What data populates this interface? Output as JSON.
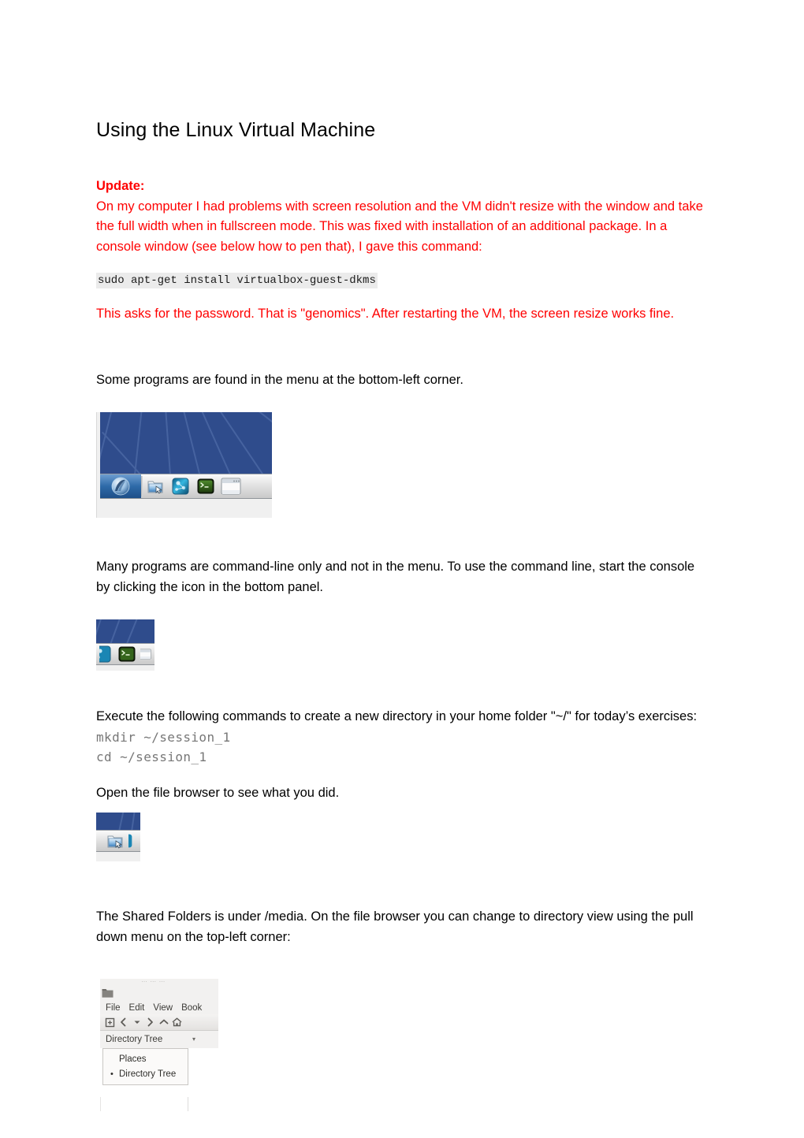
{
  "document": {
    "title": "Using the Linux Virtual Machine",
    "update_heading": "Update:",
    "update_paragraph": "On my computer I had problems with screen resolution and the VM didn't resize with the window and take the full width when in fullscreen mode. This was fixed with installation of an additional package. In a console window (see below how to pen that), I gave this command:",
    "install_command": "sudo apt-get install virtualbox-guest-dkms",
    "password_paragraph": "This asks for the password. That is \"genomics\". After restarting the VM, the screen resize works fine.",
    "menu_paragraph": "Some programs are found in the menu at the bottom-left corner.",
    "commandline_paragraph": "Many programs are command-line only and not in the menu. To use the command line, start the console by clicking the icon in the bottom panel.",
    "exercise_paragraph": "Execute the following commands to create a new directory in your home folder \"~/\" for today’s exercises:",
    "mkdir_command": "mkdir ~/session_1",
    "cd_command": "cd ~/session_1",
    "filebrowser_paragraph": "Open the file browser to see what you did.",
    "shared_folders_paragraph": "The Shared Folders is under /media. On the file browser you can change to directory view using the pull down menu on the top-left corner:"
  },
  "colors": {
    "red_text": "#ff0000",
    "body_text": "#000000",
    "code_shaded_background": "#ebebeb",
    "code_plain_text": "#777777",
    "desktop_wallpaper_blue": "#2f4c8c",
    "wallpaper_ray_blue": "#4663a0",
    "panel_gray": "#e3e3e3",
    "menu_button_blue": "#2e6aa8",
    "terminal_green": "#3e6b21",
    "filebrowser_chrome": "#f2f1f0"
  },
  "screenshot_taskbar": {
    "caption": "desktop with bottom panel",
    "icons": [
      {
        "name": "application-menu-launcher",
        "label": "Menu",
        "highlighted": true
      },
      {
        "name": "file-browser-launcher",
        "label": "File Browser"
      },
      {
        "name": "network-app-launcher",
        "label": "Network"
      },
      {
        "name": "terminal-launcher",
        "label": "Terminal"
      },
      {
        "name": "window-list-item",
        "label": "Window"
      }
    ]
  },
  "screenshot_terminal_crop": {
    "caption": "bottom panel terminal icon",
    "icons": [
      {
        "name": "network-app-launcher",
        "label": "Network"
      },
      {
        "name": "terminal-launcher",
        "label": "Terminal"
      },
      {
        "name": "window-list-item",
        "label": "Window"
      }
    ]
  },
  "screenshot_filebrowser_crop": {
    "caption": "bottom panel file browser icon",
    "icons": [
      {
        "name": "file-browser-launcher",
        "label": "File Browser"
      }
    ]
  },
  "screenshot_filebrowser_menu": {
    "title_ghost": "… … …",
    "menubar": [
      "File",
      "Edit",
      "View",
      "Book"
    ],
    "toolbar": [
      {
        "name": "new-tab-icon",
        "glyph": "+"
      },
      {
        "name": "back-arrow-icon",
        "glyph": "‹"
      },
      {
        "name": "history-dropdown-icon",
        "glyph": "▾"
      },
      {
        "name": "forward-arrow-icon",
        "glyph": "›"
      },
      {
        "name": "up-arrow-icon",
        "glyph": "˄"
      },
      {
        "name": "home-icon",
        "glyph": "⌂"
      }
    ],
    "combo_selected": "Directory Tree",
    "combo_arrow": "▾",
    "dropdown_options": [
      {
        "label": "Places",
        "selected": false
      },
      {
        "label": "Directory Tree",
        "selected": true
      }
    ]
  }
}
